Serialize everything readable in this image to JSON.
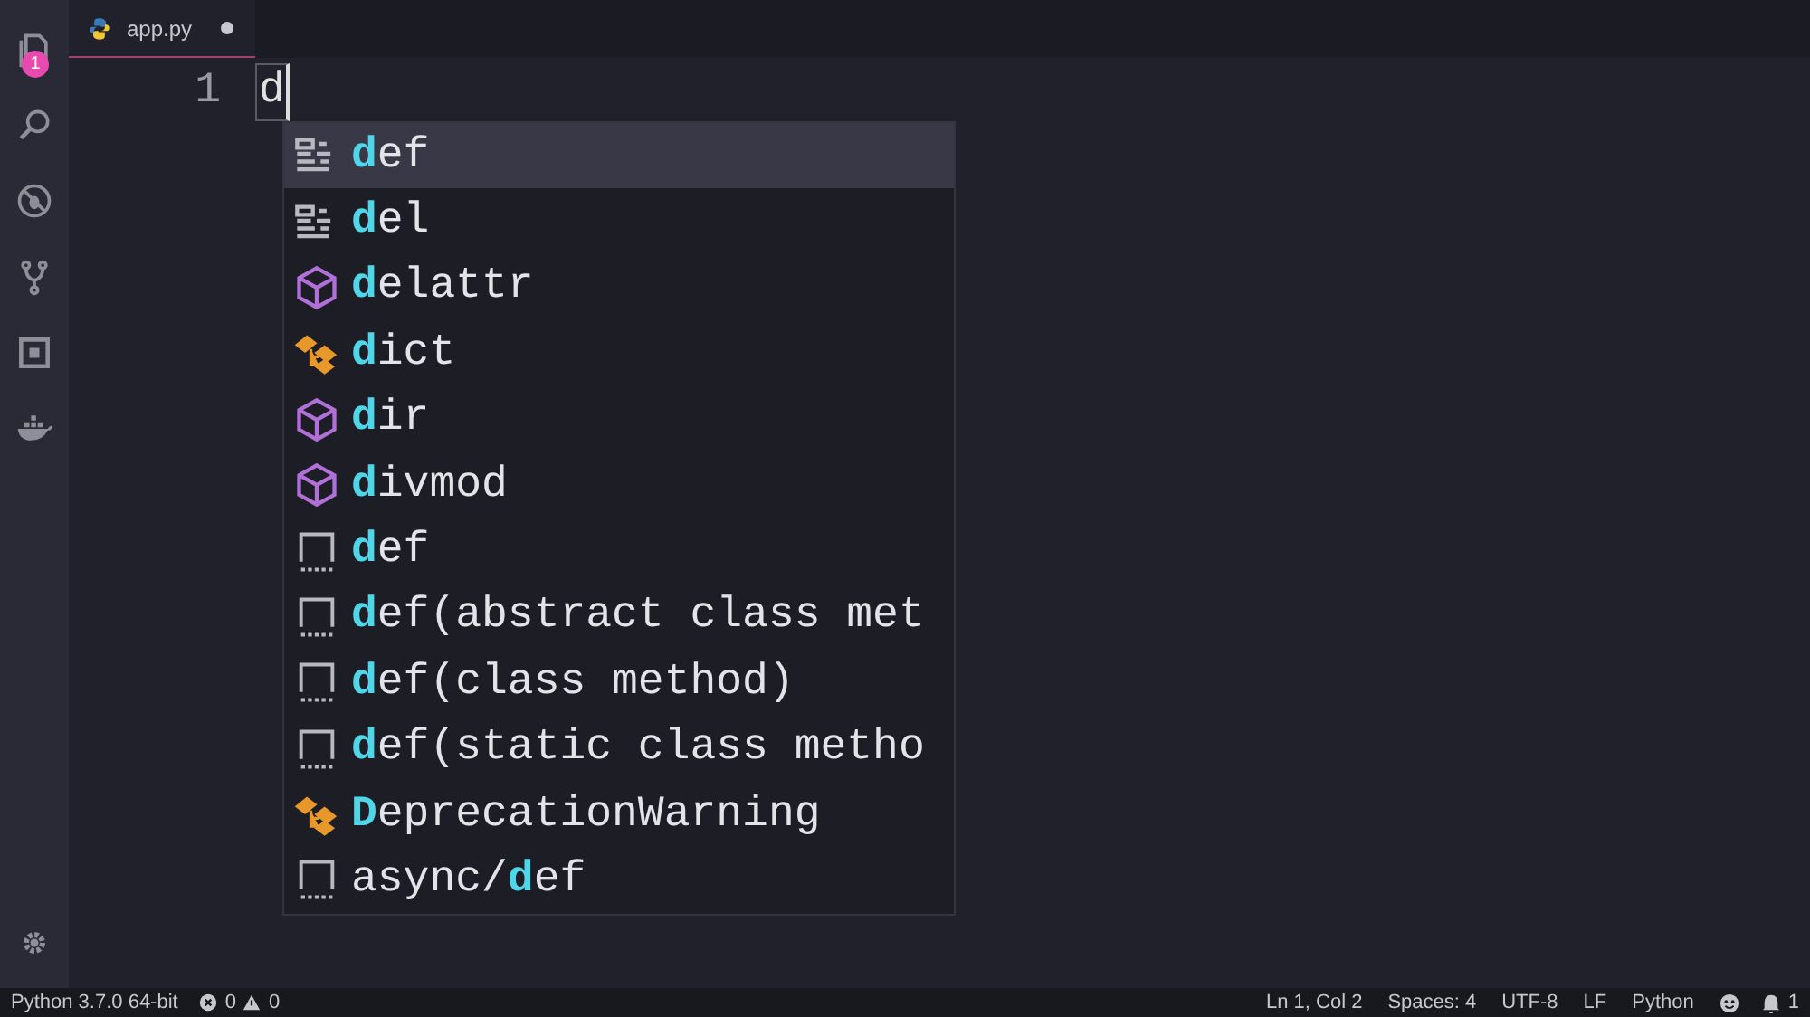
{
  "activity_bar": {
    "explorer_badge": "1"
  },
  "tabs": [
    {
      "label": "app.py",
      "selected": true,
      "modified": true
    }
  ],
  "editor": {
    "line_number": "1",
    "text": "d"
  },
  "suggestions": [
    {
      "kind": "keyword",
      "match": "d",
      "after": "ef",
      "selected": true
    },
    {
      "kind": "keyword",
      "match": "d",
      "after": "el",
      "selected": false
    },
    {
      "kind": "function",
      "match": "d",
      "after": "elattr",
      "selected": false
    },
    {
      "kind": "class",
      "match": "d",
      "after": "ict",
      "selected": false
    },
    {
      "kind": "function",
      "match": "d",
      "after": "ir",
      "selected": false
    },
    {
      "kind": "function",
      "match": "d",
      "after": "ivmod",
      "selected": false
    },
    {
      "kind": "snippet",
      "match": "d",
      "after": "ef",
      "selected": false
    },
    {
      "kind": "snippet",
      "match": "d",
      "after": "ef(abstract class met",
      "selected": false
    },
    {
      "kind": "snippet",
      "match": "d",
      "after": "ef(class method)",
      "selected": false
    },
    {
      "kind": "snippet",
      "match": "d",
      "after": "ef(static class metho",
      "selected": false
    },
    {
      "kind": "class",
      "match": "D",
      "after": "eprecationWarning",
      "selected": false
    },
    {
      "kind": "snippet",
      "before": "async/",
      "match": "d",
      "after": "ef",
      "selected": false
    }
  ],
  "status_bar": {
    "interpreter": "Python 3.7.0 64-bit",
    "errors": "0",
    "warnings": "0",
    "position": "Ln 1, Col 2",
    "indentation": "Spaces: 4",
    "encoding": "UTF-8",
    "line_ending": "LF",
    "language": "Python",
    "notifications": "1"
  }
}
